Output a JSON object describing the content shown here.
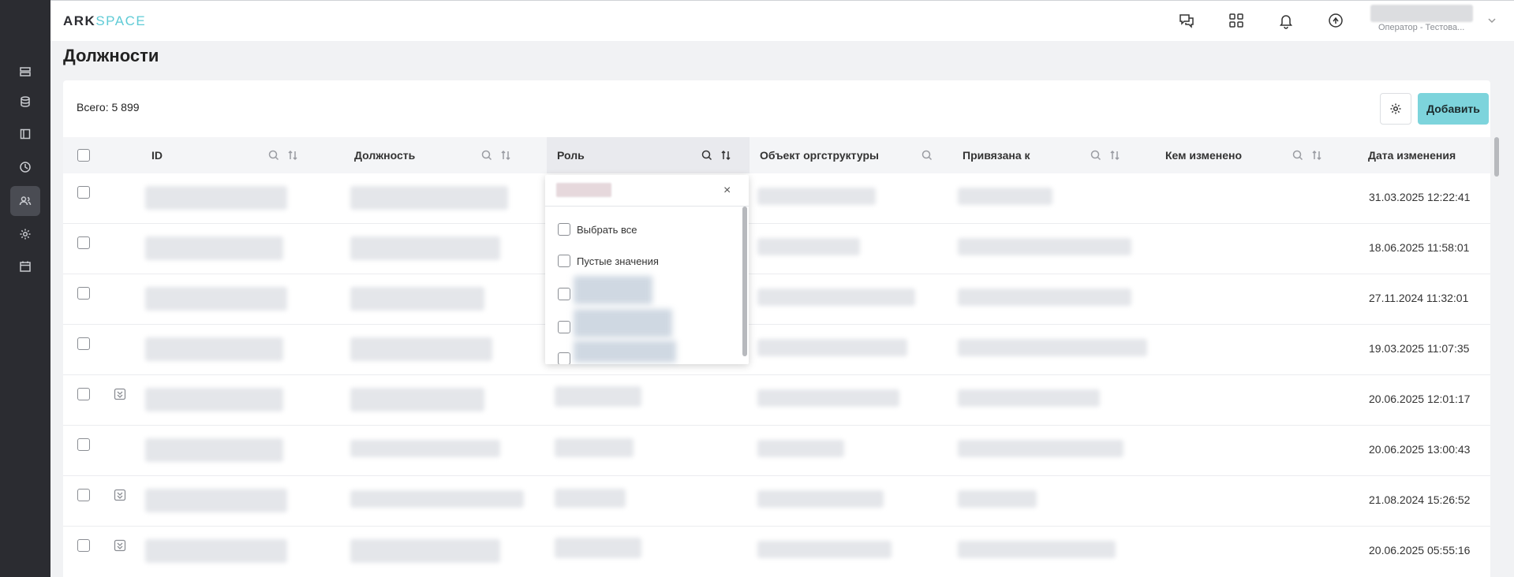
{
  "logo": {
    "part1": "ARK",
    "part2": "SPACE"
  },
  "header": {
    "user_role": "Оператор - Тестова...",
    "icons": [
      "support-chat-icon",
      "apps-grid-icon",
      "notifications-bell-icon",
      "sync-icon"
    ]
  },
  "sidebar": {
    "items": [
      "queue-icon",
      "database-icon",
      "book-icon",
      "clock-icon",
      "users-icon",
      "settings-gear-icon",
      "calendar-icon"
    ],
    "active": "users-icon"
  },
  "page": {
    "title": "Должности"
  },
  "toolbar": {
    "total": "Всего: 5 899",
    "add_label": "Добавить"
  },
  "table": {
    "columns": [
      {
        "label": "ID",
        "search": true,
        "sort": true
      },
      {
        "label": "Должность",
        "search": true,
        "sort": true
      },
      {
        "label": "Роль",
        "search": true,
        "sort": true,
        "active": true
      },
      {
        "label": "Объект оргструктуры",
        "search": true,
        "sort": false
      },
      {
        "label": "Привязана к",
        "search": true,
        "sort": true
      },
      {
        "label": "Кем изменено",
        "search": true,
        "sort": true
      },
      {
        "label": "Дата изменения",
        "search": false,
        "sort": false
      }
    ],
    "rows": [
      {
        "date": "31.03.2025 12:22:41",
        "expandable": false
      },
      {
        "date": "18.06.2025 11:58:01",
        "expandable": false
      },
      {
        "date": "27.11.2024 11:32:01",
        "expandable": false
      },
      {
        "date": "19.03.2025 11:07:35",
        "expandable": false
      },
      {
        "date": "20.06.2025 12:01:17",
        "expandable": true
      },
      {
        "date": "20.06.2025 13:00:43",
        "expandable": false
      },
      {
        "date": "21.08.2024 15:26:52",
        "expandable": true
      },
      {
        "date": "20.06.2025 05:55:16",
        "expandable": true
      }
    ]
  },
  "role_filter": {
    "select_all": "Выбрать все",
    "empty_values": "Пустые значения",
    "close": "×"
  },
  "colors": {
    "sidebar": "#2b2c31",
    "accent": "#7dd4dc",
    "logo_accent": "#5fcbd6"
  }
}
